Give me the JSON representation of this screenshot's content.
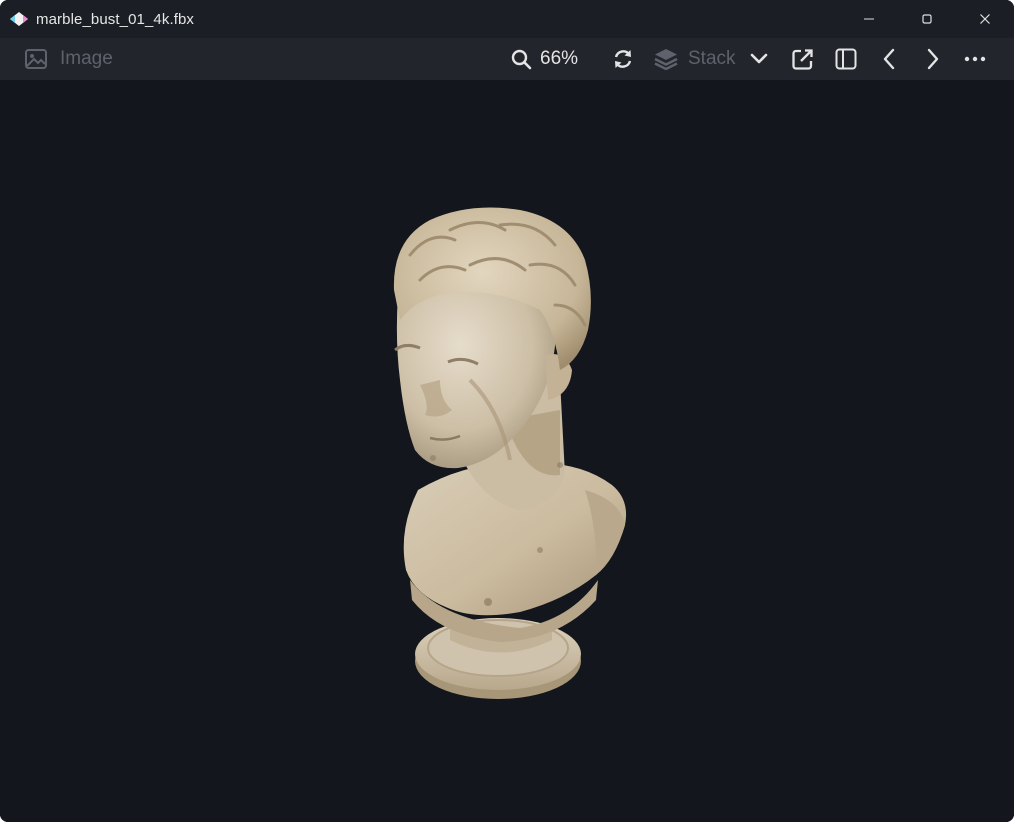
{
  "window": {
    "title": "marble_bust_01_4k.fbx",
    "controls": {
      "minimize": "minimize-icon",
      "maximize": "maximize-icon",
      "close": "close-icon"
    }
  },
  "toolbar": {
    "image_label": "Image",
    "zoom_level": "66%",
    "stack_label": "Stack"
  },
  "colors": {
    "background": "#13161c",
    "titlebar": "#1b1e24",
    "toolbar": "#22252c",
    "marble": "#d8cdb8"
  }
}
